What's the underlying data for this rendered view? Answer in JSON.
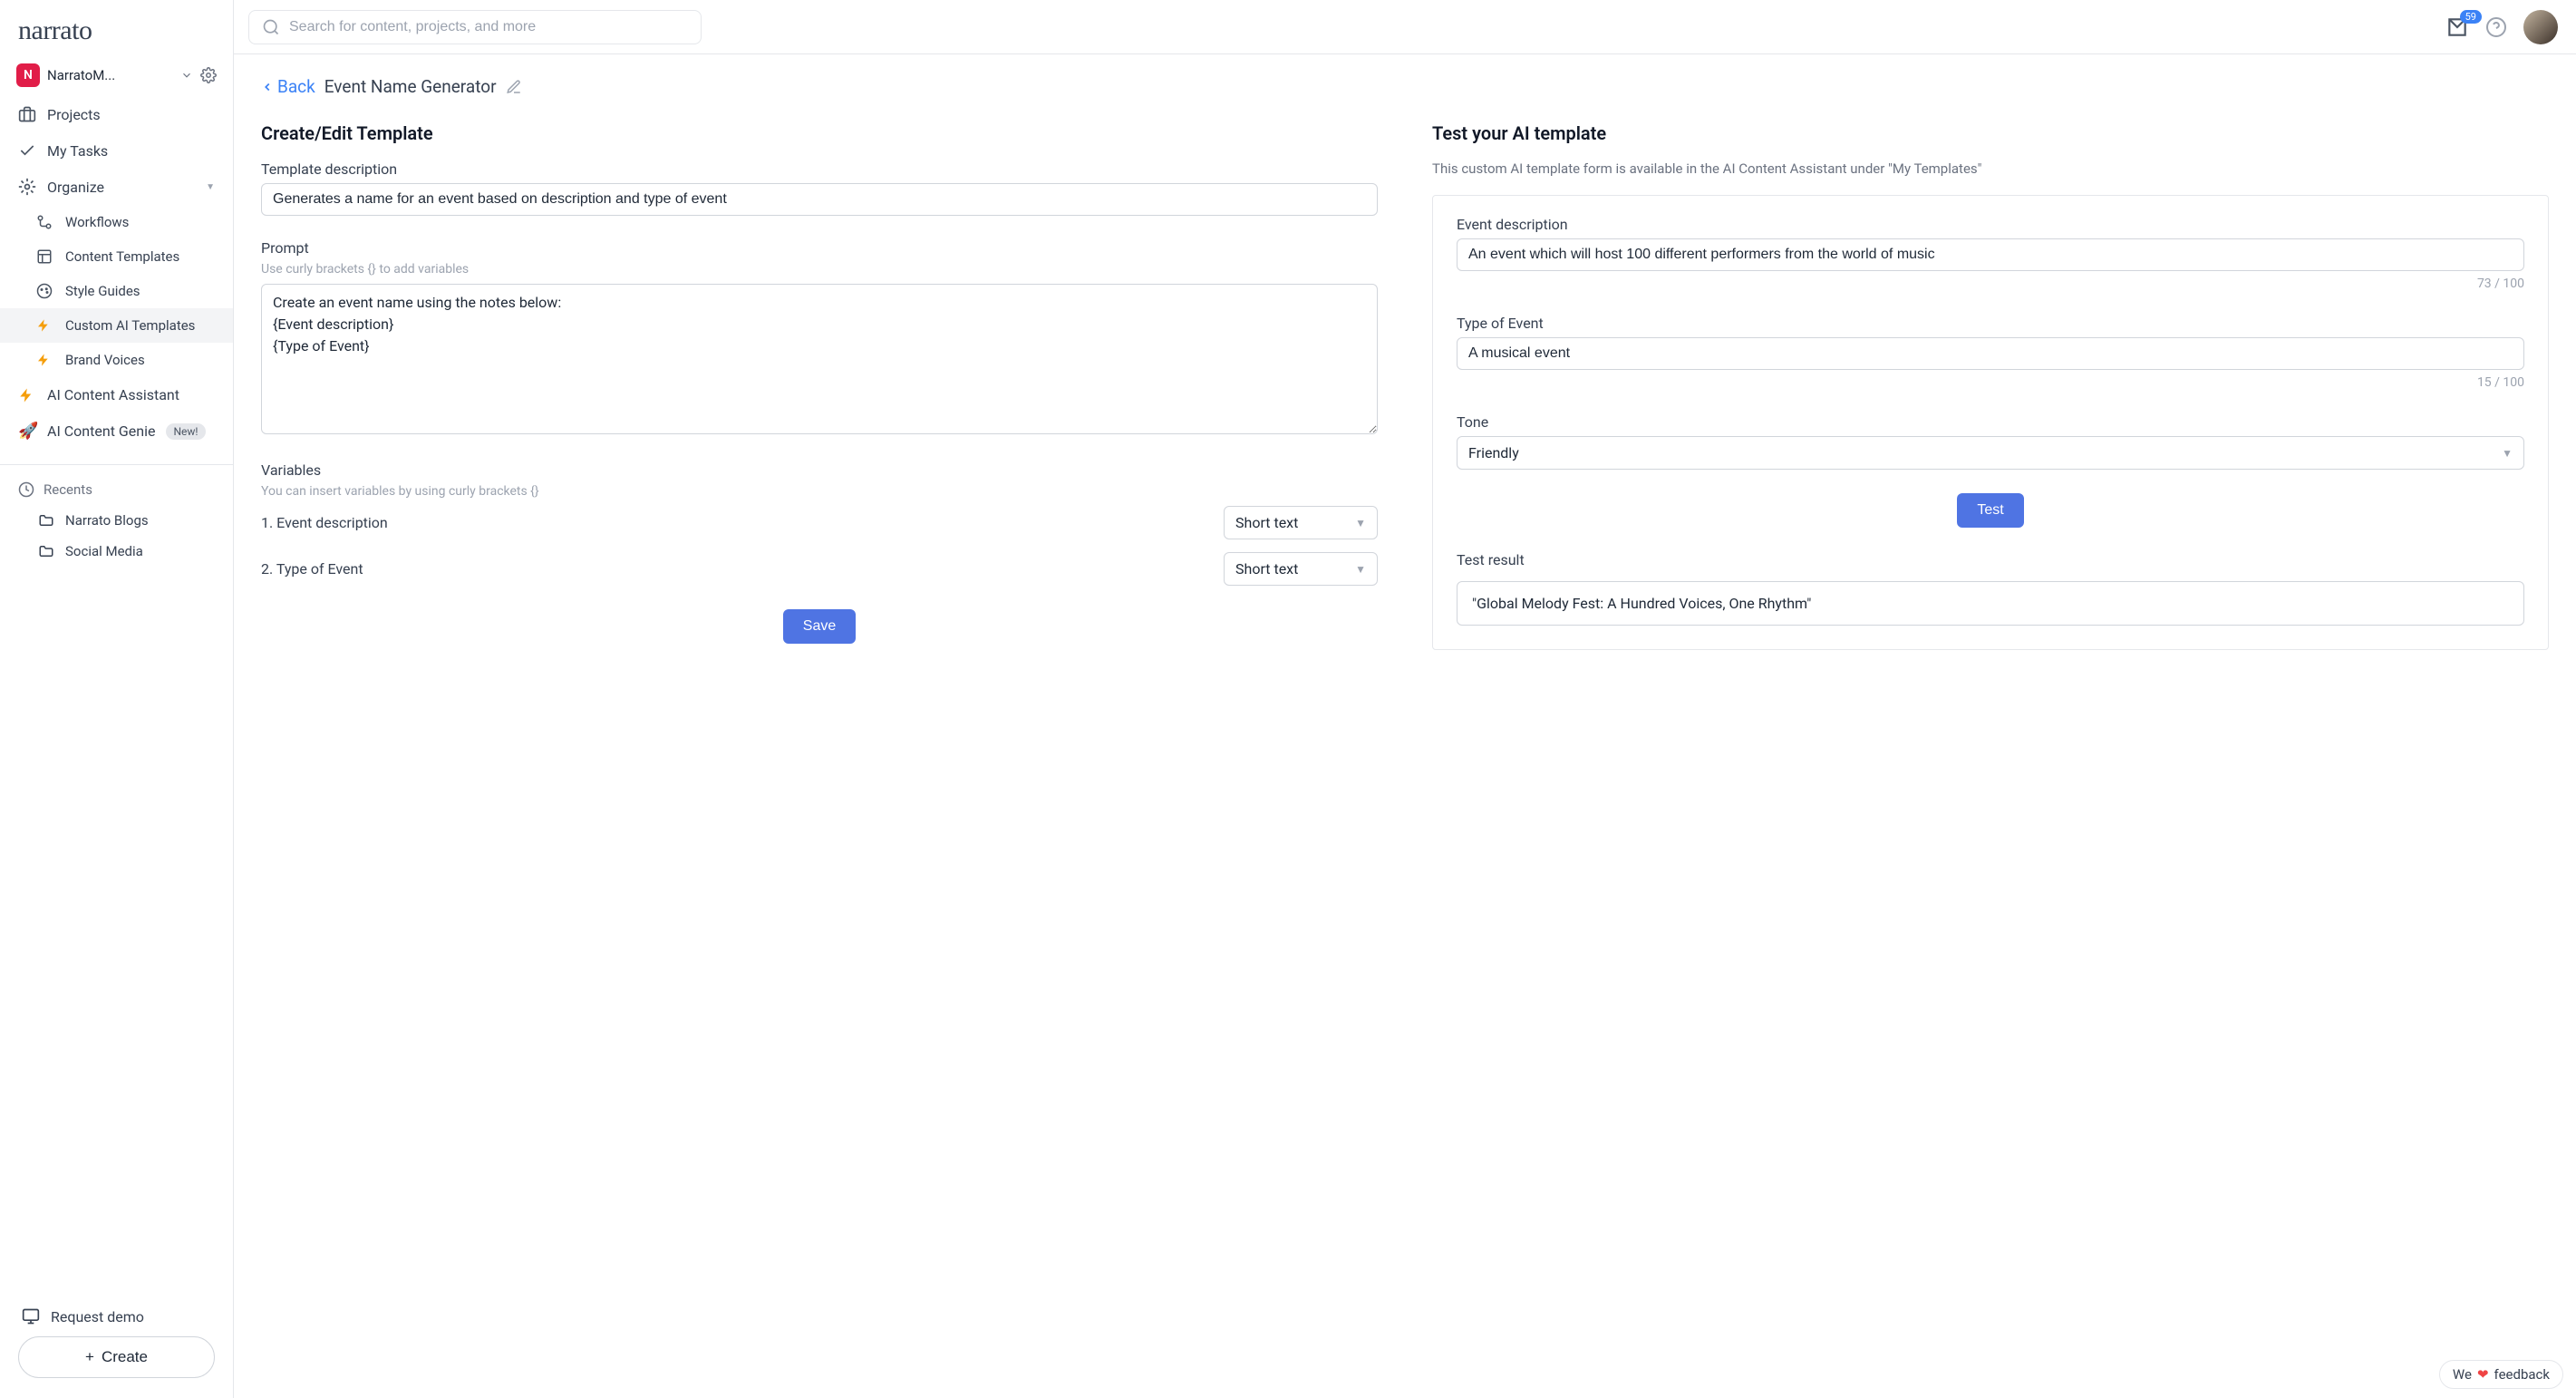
{
  "brand": "narrato",
  "workspace": {
    "initial": "N",
    "name": "NarratoM..."
  },
  "search": {
    "placeholder": "Search for content, projects, and more"
  },
  "topbar": {
    "mail_badge": "59"
  },
  "sidebar": {
    "items": [
      {
        "label": "Projects"
      },
      {
        "label": "My Tasks"
      },
      {
        "label": "Organize"
      }
    ],
    "organize_children": [
      {
        "label": "Workflows"
      },
      {
        "label": "Content Templates"
      },
      {
        "label": "Style Guides"
      },
      {
        "label": "Custom AI Templates"
      },
      {
        "label": "Brand Voices"
      }
    ],
    "ai_assistant": "AI Content Assistant",
    "ai_genie": "AI Content Genie",
    "ai_genie_badge": "New!",
    "recents": {
      "heading": "Recents",
      "items": [
        "Narrato Blogs",
        "Social Media"
      ]
    },
    "request_demo": "Request demo",
    "create": "Create"
  },
  "page": {
    "back": "Back",
    "title": "Event Name Generator"
  },
  "left": {
    "heading": "Create/Edit Template",
    "template_description_label": "Template description",
    "template_description_value": "Generates a name for an event based on description and type of event",
    "prompt_label": "Prompt",
    "prompt_hint": "Use curly brackets {} to add variables",
    "prompt_value": "Create an event name using the notes below:\n{Event description}\n{Type of Event}",
    "variables_label": "Variables",
    "variables_hint": "You can insert variables by using curly brackets {}",
    "variables": [
      {
        "label": "1. Event description",
        "type": "Short text"
      },
      {
        "label": "2. Type of Event",
        "type": "Short text"
      }
    ],
    "save_label": "Save"
  },
  "right": {
    "heading": "Test your AI template",
    "subtext": "This custom AI template form is available in the AI Content Assistant under \"My Templates\"",
    "event_description_label": "Event description",
    "event_description_value": "An event which will host 100 different performers from the world of music",
    "event_description_count": "73 / 100",
    "type_label": "Type of Event",
    "type_value": "A musical event",
    "type_count": "15 / 100",
    "tone_label": "Tone",
    "tone_value": "Friendly",
    "test_button": "Test",
    "test_result_label": "Test result",
    "test_result_value": "\"Global Melody Fest: A Hundred Voices, One Rhythm\""
  },
  "feedback": {
    "we": "We",
    "label": "feedback"
  }
}
